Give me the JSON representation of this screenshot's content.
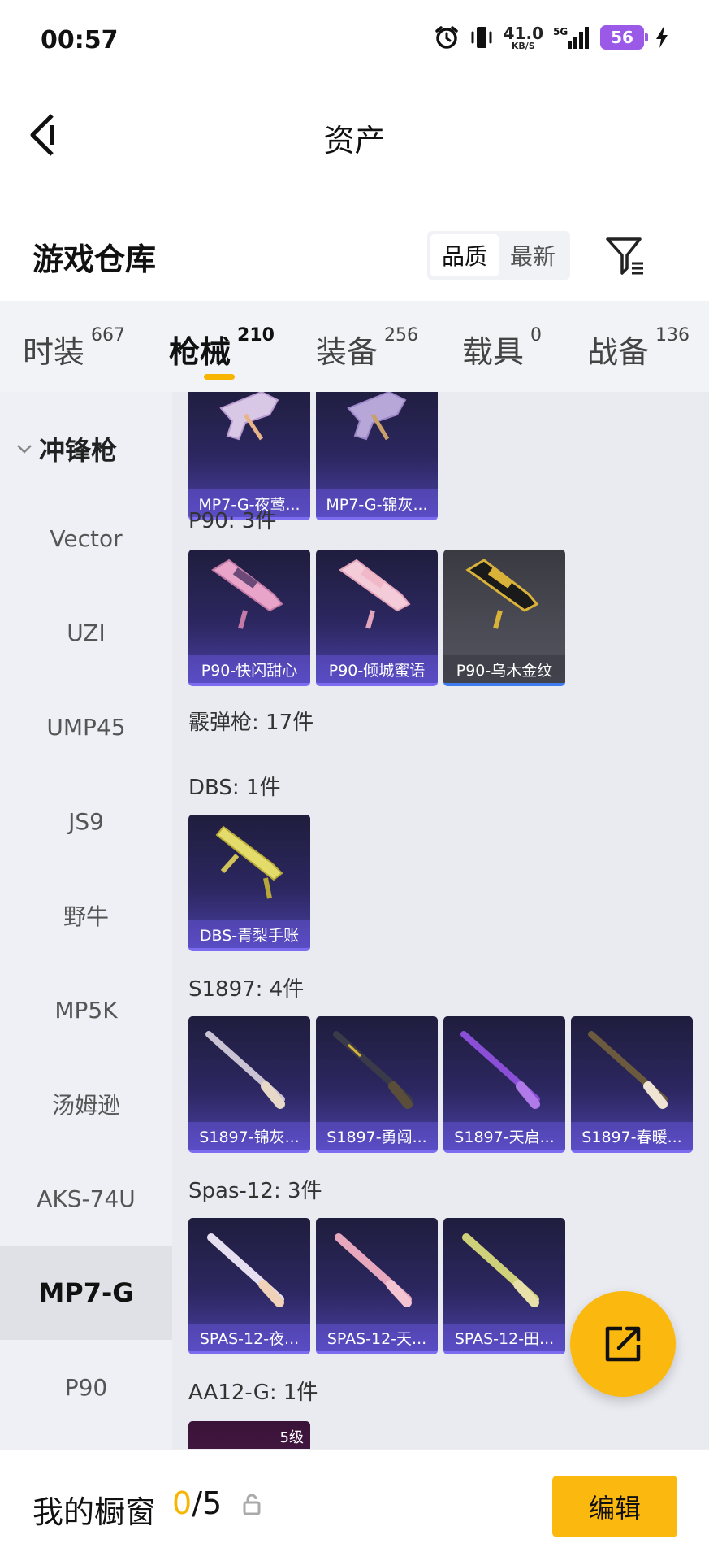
{
  "status": {
    "time": "00:57",
    "speed_value": "41.0",
    "speed_unit": "KB/S",
    "network": "5G",
    "battery": "56"
  },
  "header": {
    "title": "资产"
  },
  "section": {
    "title": "游戏仓库",
    "sort_options": [
      "品质",
      "最新"
    ],
    "active_sort": "品质"
  },
  "tabs": [
    {
      "label": "时装",
      "count": "667"
    },
    {
      "label": "枪械",
      "count": "210"
    },
    {
      "label": "装备",
      "count": "256"
    },
    {
      "label": "载具",
      "count": "0"
    },
    {
      "label": "战备",
      "count": "136"
    }
  ],
  "active_tab": "枪械",
  "sidebar": {
    "group": "冲锋枪",
    "items": [
      "Vector",
      "UZI",
      "UMP45",
      "JS9",
      "野牛",
      "MP5K",
      "汤姆逊",
      "AKS-74U",
      "MP7-G",
      "P90"
    ],
    "active": "MP7-G"
  },
  "content": {
    "mp7_cards": [
      "MP7-G-夜莺...",
      "MP7-G-锦灰..."
    ],
    "p90": {
      "label": "P90: 3件",
      "cards": [
        "P90-快闪甜心",
        "P90-倾城蜜语",
        "P90-乌木金纹"
      ]
    },
    "shotgun_group": "霰弹枪: 17件",
    "dbs": {
      "label": "DBS: 1件",
      "cards": [
        "DBS-青梨手账"
      ]
    },
    "s1897": {
      "label": "S1897: 4件",
      "cards": [
        "S1897-锦灰...",
        "S1897-勇闯...",
        "S1897-天启...",
        "S1897-春暖..."
      ]
    },
    "spas12": {
      "label": "Spas-12: 3件",
      "cards": [
        "SPAS-12-夜...",
        "SPAS-12-天...",
        "SPAS-12-田..."
      ]
    },
    "aa12": {
      "label": "AA12-G: 1件",
      "tier": "5级"
    }
  },
  "bottom": {
    "title": "我的橱窗",
    "current": "0",
    "total": "/5",
    "edit_label": "编辑"
  },
  "colors": {
    "accent": "#f7b500",
    "battery": "#9b59e8",
    "card_purple": "#4a40a5"
  },
  "icons": [
    "alarm-icon",
    "vibrate-icon",
    "signal-icon",
    "charging-icon",
    "back-icon",
    "filter-icon",
    "chevron-down-icon",
    "share-icon",
    "lock-icon"
  ]
}
